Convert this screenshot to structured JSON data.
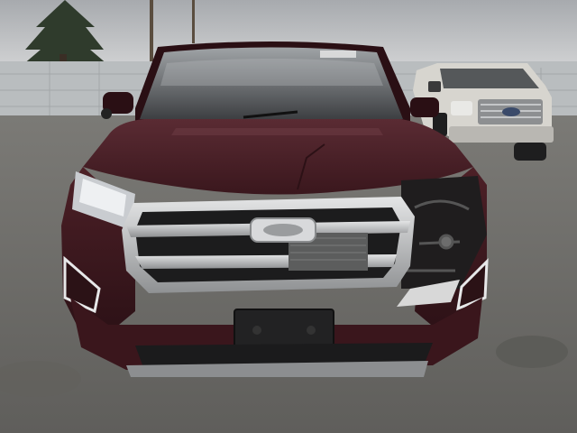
{
  "scene": {
    "subject": "damaged-suv-front",
    "colors": {
      "sky": "#c9cbcd",
      "sky_top": "#a9acb0",
      "fence": "#b9bdbf",
      "ground": "#6a6966",
      "body_paint": "#4a1f26",
      "body_shadow": "#2c1116",
      "grille_chrome": "#b8b9bb",
      "bumper_black": "#2a2a2c",
      "truck_white": "#d7d5cf",
      "tree": "#2f3b2c"
    }
  }
}
